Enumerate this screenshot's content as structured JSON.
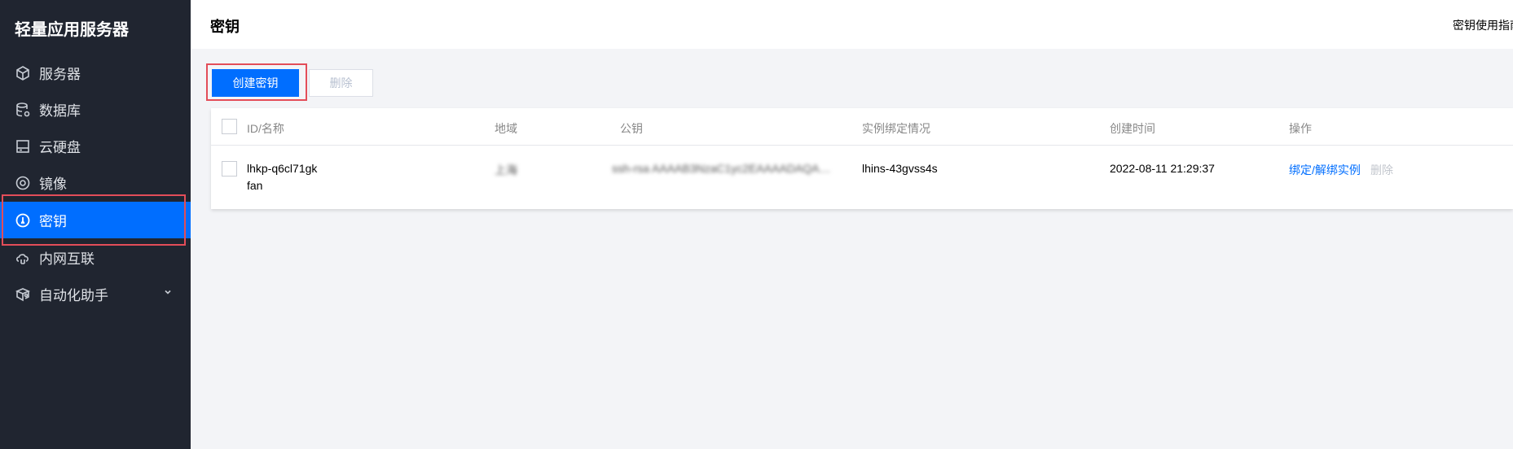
{
  "sidebar": {
    "title": "轻量应用服务器",
    "items": [
      {
        "label": "服务器",
        "icon": "cube-icon",
        "active": false
      },
      {
        "label": "数据库",
        "icon": "database-icon",
        "active": false
      },
      {
        "label": "云硬盘",
        "icon": "disk-icon",
        "active": false
      },
      {
        "label": "镜像",
        "icon": "image-disc-icon",
        "active": false
      },
      {
        "label": "密钥",
        "icon": "key-icon",
        "active": true
      },
      {
        "label": "内网互联",
        "icon": "cloud-link-icon",
        "active": false
      },
      {
        "label": "自动化助手",
        "icon": "automation-icon",
        "active": false,
        "has_submenu": true
      }
    ]
  },
  "header": {
    "title": "密钥",
    "help_link": "密钥使用指南"
  },
  "toolbar": {
    "create_label": "创建密钥",
    "delete_label": "删除"
  },
  "table": {
    "columns": [
      "ID/名称",
      "地域",
      "公钥",
      "实例绑定情况",
      "创建时间",
      "操作"
    ],
    "rows": [
      {
        "id": "lhkp-q6cl71gk",
        "name": "fan",
        "region": "上海",
        "public_key": "ssh-rsa AAAAB3NzaC1yc2EAAAADAQABAAABAQC...",
        "instance": "lhins-43gvss4s",
        "created": "2022-08-11 21:29:37",
        "action_bind": "绑定/解绑实例",
        "action_delete": "删除"
      }
    ]
  },
  "colors": {
    "sidebar_bg": "#202530",
    "accent": "#006eff",
    "highlight_border": "#e34d59"
  }
}
